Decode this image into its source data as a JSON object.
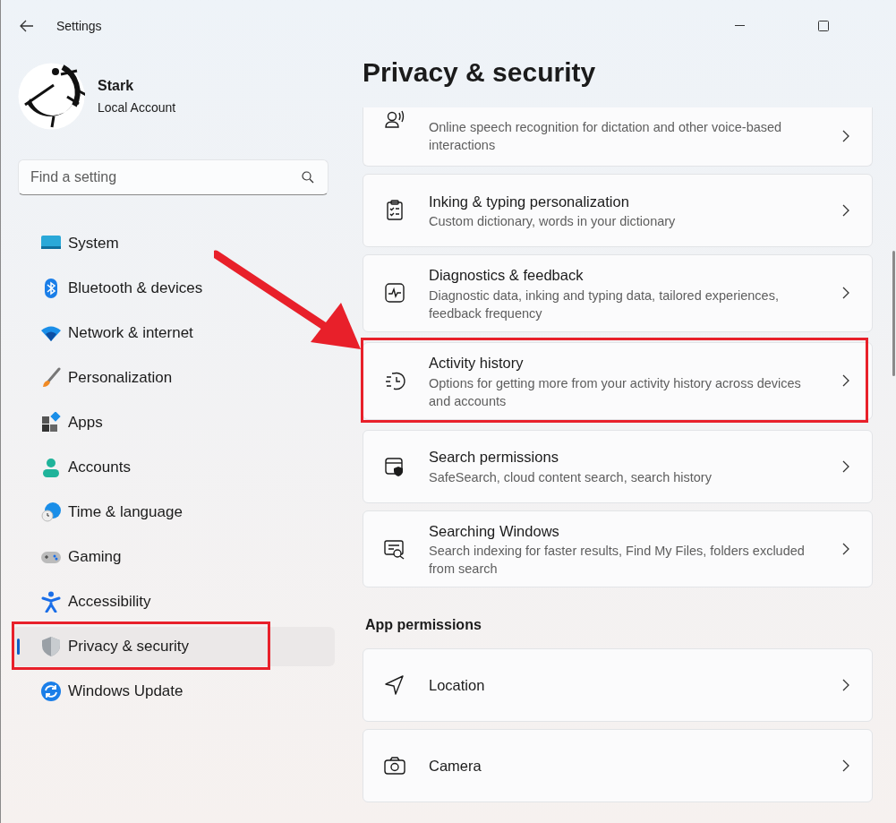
{
  "window": {
    "title": "Settings"
  },
  "account": {
    "name": "Stark",
    "type": "Local Account"
  },
  "search": {
    "placeholder": "Find a setting"
  },
  "sidebar": {
    "items": [
      {
        "label": "System",
        "kind": "system",
        "selected": false,
        "highlighted": false
      },
      {
        "label": "Bluetooth & devices",
        "kind": "bluetooth",
        "selected": false,
        "highlighted": false
      },
      {
        "label": "Network & internet",
        "kind": "network",
        "selected": false,
        "highlighted": false
      },
      {
        "label": "Personalization",
        "kind": "brush",
        "selected": false,
        "highlighted": false
      },
      {
        "label": "Apps",
        "kind": "apps",
        "selected": false,
        "highlighted": false
      },
      {
        "label": "Accounts",
        "kind": "accounts",
        "selected": false,
        "highlighted": false
      },
      {
        "label": "Time & language",
        "kind": "time",
        "selected": false,
        "highlighted": false
      },
      {
        "label": "Gaming",
        "kind": "gaming",
        "selected": false,
        "highlighted": false
      },
      {
        "label": "Accessibility",
        "kind": "accessibility",
        "selected": false,
        "highlighted": false
      },
      {
        "label": "Privacy & security",
        "kind": "shield",
        "selected": true,
        "highlighted": true
      },
      {
        "label": "Windows Update",
        "kind": "update",
        "selected": false,
        "highlighted": false
      }
    ]
  },
  "page": {
    "title": "Privacy & security",
    "items": [
      {
        "kind": "speech",
        "description": "Online speech recognition for dictation and other voice-based interactions",
        "highlighted": false
      },
      {
        "kind": "inking",
        "title": "Inking & typing personalization",
        "description": "Custom dictionary, words in your dictionary",
        "highlighted": false
      },
      {
        "kind": "diagnostics",
        "title": "Diagnostics & feedback",
        "description": "Diagnostic data, inking and typing data, tailored experiences, feedback frequency",
        "highlighted": false
      },
      {
        "kind": "history",
        "title": "Activity history",
        "description": "Options for getting more from your activity history across devices and accounts",
        "highlighted": true
      },
      {
        "kind": "search",
        "title": "Search permissions",
        "description": "SafeSearch, cloud content search, search history",
        "highlighted": false
      },
      {
        "kind": "searching",
        "title": "Searching Windows",
        "description": "Search indexing for faster results, Find My Files, folders excluded from search",
        "highlighted": false
      }
    ],
    "section": "App permissions",
    "permissions": [
      {
        "kind": "location",
        "title": "Location",
        "highlighted": false
      },
      {
        "kind": "camera",
        "title": "Camera",
        "highlighted": false
      }
    ]
  }
}
